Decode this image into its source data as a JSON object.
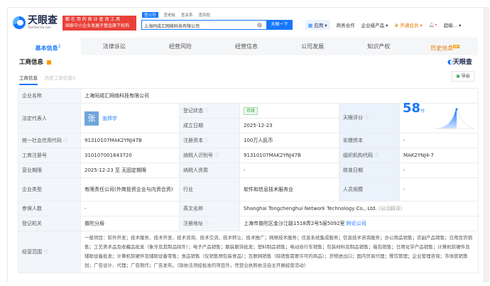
{
  "brand": {
    "name": "天眼查",
    "domain": "TianYanCha.com",
    "ad_line1": "都 在 用 的 商 业 查 询 工 具",
    "ad_line2": "国家中小企业发展子基金旗下机构"
  },
  "search": {
    "tabs": [
      "查公司",
      "查老板",
      "查关系",
      "查风险"
    ],
    "value": "上海同成汇网络科技有限公司",
    "button": "天眼一下"
  },
  "topnav": {
    "app": "应用",
    "coop": "商务合作",
    "enterprise": "企业级产品",
    "vip": "开通会员",
    "user": "超级..."
  },
  "tabs": [
    {
      "label": "基本信息",
      "count": "2"
    },
    {
      "label": "法律诉讼"
    },
    {
      "label": "经营风险"
    },
    {
      "label": "经营信息"
    },
    {
      "label": "公司发展"
    },
    {
      "label": "知识产权"
    },
    {
      "label": "历史信息",
      "badge": "VIP"
    }
  ],
  "section": {
    "title": "工商信息",
    "watermark": "天眼查",
    "subtab_active": "工商信息",
    "subtab_other": "历史工商信息0",
    "export": "导出"
  },
  "info": {
    "name_label": "企业名称",
    "name": "上海同成汇网络科技有限公司",
    "legal_label": "法定代表人",
    "legal_avatar": "张",
    "legal": "张邦宇",
    "status_label": "登记状态",
    "status": "存续",
    "found_label": "成立日期",
    "found": "2025-12-23",
    "score_label": "天眼评分",
    "score": "58",
    "score_unit": "分",
    "credit_label": "统一社会信用代码",
    "credit": "91310107MAK2YNJ47B",
    "capital_label": "注册资本",
    "capital": "100万人民币",
    "paid_label": "实缴资本",
    "paid": "-",
    "regno_label": "工商注册号",
    "regno": "310107001643720",
    "taxid_label": "纳税人识别号",
    "taxid": "91310107MAK2YNJ47B",
    "org_label": "组织机构代码",
    "org": "MAK2YNJ4-7",
    "term_label": "营业期限",
    "term": "2025-12-23 至 无固定期限",
    "taxq_label": "纳税人资质",
    "taxq": "-",
    "approve_label": "核准日期",
    "approve": "-",
    "type_label": "企业类型",
    "type": "有限责任公司(外商投资企业与内资合资)",
    "industry_label": "行业",
    "industry": "软件和信息技术服务业",
    "staff_label": "人员规模",
    "staff": "-",
    "insured_label": "参保人数",
    "insured": "-",
    "en_label": "英文名称",
    "en": "Shanghai Tongchenghui Network Technology Co., Ltd.",
    "en_note": "(自动翻译)",
    "authority_label": "登记机关",
    "authority": "普陀分局",
    "addr_label": "注册地址",
    "addr": "上海市普陀区金沙江路1518弄2号5层5092室",
    "addr_link": "附近公司",
    "scope_label": "经营范围",
    "scope": "一般项目：软件开发；技术服务、技术开发、技术咨询、技术交流、技术转让、技术推广；网络技术服务；信息系统集成服务；信息技术咨询服务；办公用品销售；农副产品销售；日用百货销售；工艺美术品及收藏品批发（象牙及其制品除外）；电子产品销售；服装服饰批发；塑料制品销售；电动自行车销售；包装材料及制品销售；箱包销售；日用化学产品销售；计算机软硬件及辅助设备批发；计算机软硬件及辅助设备零售；食品销售（仅销售预包装食品）；互联网销售（除销售需要许可的商品）；货物进出口；国内贸易代理；餐饮管理；企业管理咨询；市场营销策划；广告设计、代理；广告制作；广告发布。（除依法须经批准的项目外，凭营业执照依法自主开展经营活动）"
  },
  "colors": {
    "accent": "#1677ff",
    "vip": "#e87600",
    "ad": "#e8413a"
  }
}
